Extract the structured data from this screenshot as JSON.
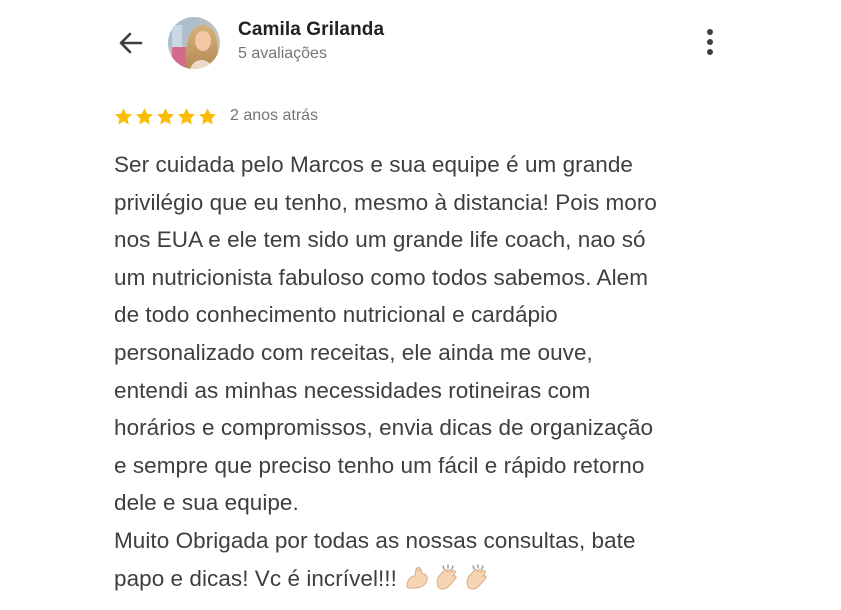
{
  "header": {
    "user_name": "Camila Grilanda",
    "review_count": "5 avaliações"
  },
  "icons": {
    "back": "arrow-back-icon",
    "more": "more-vert-icon",
    "star": "star-icon",
    "muscle": "flexed-biceps-emoji",
    "clap": "clapping-hands-emoji"
  },
  "rating": {
    "stars": 5,
    "max_stars": 5,
    "date": "2 anos atrás"
  },
  "review": {
    "text": "Ser cuidada pelo Marcos e sua equipe é um grande\nprivilégio que eu tenho, mesmo à distancia! Pois moro\nnos EUA e ele tem sido um grande life coach, nao só\num nutricionista fabuloso como todos sabemos. Alem\nde todo conhecimento nutricional e cardápio\npersonalizado com receitas, ele ainda me ouve,\nentendi as minhas necessidades rotineiras com\nhorários e compromissos, envia dicas de organização\ne sempre que preciso tenho um fácil e rápido retorno\ndele e sua equipe.\nMuito Obrigada por todas as nossas consultas, bate\npapo e dicas! Vc é incrível!!!"
  },
  "colors": {
    "star": "#fbbc04",
    "text": "#3c4043",
    "secondary": "#70757a",
    "name": "#202124"
  }
}
